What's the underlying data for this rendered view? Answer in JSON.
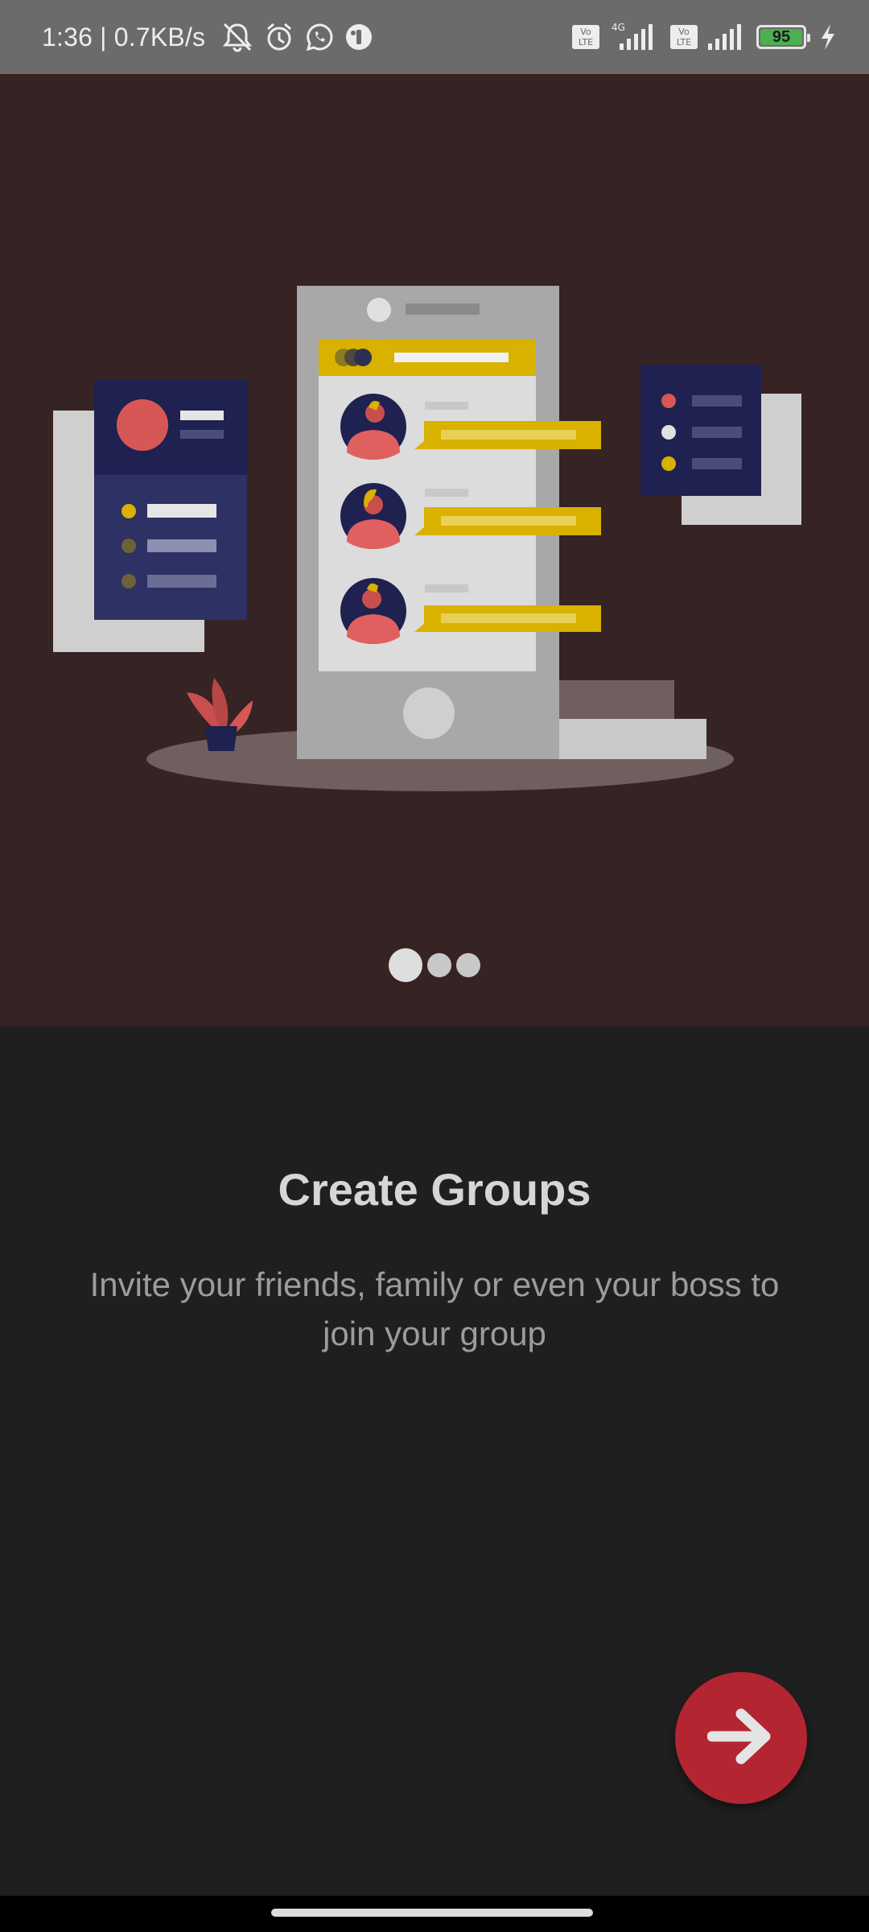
{
  "status_bar": {
    "time": "1:36 | 0.7KB/s",
    "left_icons": [
      "bell-off-icon",
      "alarm-icon",
      "whatsapp-icon",
      "app-notification-icon"
    ],
    "network_type": "4G",
    "volte_label": "Vo\nLTE",
    "battery_level": "95",
    "charging": true
  },
  "onboarding": {
    "page_count": 3,
    "active_page": 1,
    "title": "Create Groups",
    "subtitle": "Invite your friends, family or even your boss to join your group",
    "next_icon": "arrow-right-icon"
  },
  "colors": {
    "hero_background": "#362323",
    "content_background": "#1f1f1f",
    "accent": "#b32530",
    "illustration_yellow": "#d9b200",
    "illustration_navy": "#1f2150"
  }
}
